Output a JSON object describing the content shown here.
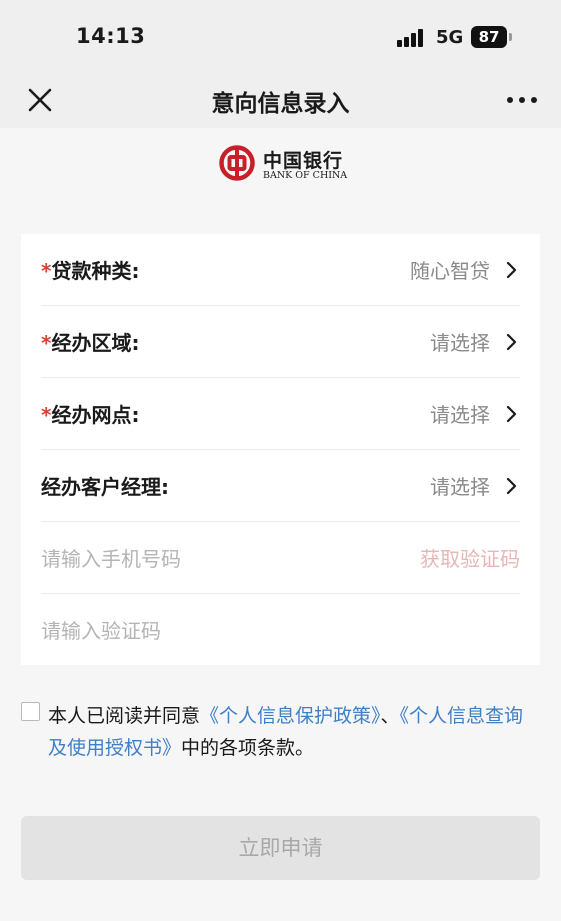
{
  "status_bar": {
    "time": "14:13",
    "network": "5G",
    "battery": "87"
  },
  "nav": {
    "title": "意向信息录入",
    "close_icon": "close-icon",
    "more_icon": "more-icon"
  },
  "logo": {
    "name_cn": "中国银行",
    "name_en": "BANK OF CHINA",
    "brand_color": "#c8202a"
  },
  "form": {
    "rows": [
      {
        "required_mark": "*",
        "label": "贷款种类:",
        "value": "随心智贷"
      },
      {
        "required_mark": "*",
        "label": "经办区域:",
        "value": "请选择"
      },
      {
        "required_mark": "*",
        "label": "经办网点:",
        "value": "请选择"
      },
      {
        "required_mark": "",
        "label": "经办客户经理:",
        "value": "请选择"
      }
    ],
    "phone_placeholder": "请输入手机号码",
    "get_code_label": "获取验证码",
    "code_placeholder": "请输入验证码"
  },
  "agreement": {
    "text_before": "本人已阅读并同意",
    "link_privacy": "《个人信息保护政策》",
    "separator": "、",
    "link_authorization": "《个人信息查询及使用授权书》",
    "text_after": "中的各项条款。",
    "link_color": "#3f7fc6"
  },
  "submit": {
    "label": "立即申请"
  }
}
